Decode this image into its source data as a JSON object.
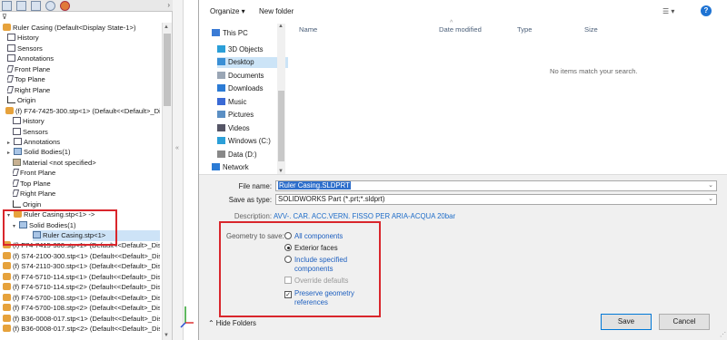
{
  "tree": {
    "items": [
      {
        "text": "Ruler Casing  (Default<Display State-1>)"
      },
      {
        "text": "History"
      },
      {
        "text": "Sensors"
      },
      {
        "text": "Annotations"
      },
      {
        "text": "Front Plane"
      },
      {
        "text": "Top Plane"
      },
      {
        "text": "Right Plane"
      },
      {
        "text": "Origin"
      },
      {
        "text": "(f) F74-7425-300.stp<1> (Default<<Default>_Displ"
      },
      {
        "text": "History"
      },
      {
        "text": "Sensors"
      },
      {
        "text": "Annotations"
      },
      {
        "text": "Solid Bodies(1)"
      },
      {
        "text": "Material <not specified>"
      },
      {
        "text": "Front Plane"
      },
      {
        "text": "Top Plane"
      },
      {
        "text": "Right Plane"
      },
      {
        "text": "Origin"
      },
      {
        "text": "Ruler Casing.stp<1> ->"
      },
      {
        "text": "Solid Bodies(1)"
      },
      {
        "text": "Ruler Casing.stp<1>"
      },
      {
        "text": "(f) F74-7415-300.stp<1> (Default<<Default>_Displ"
      },
      {
        "text": "(f) S74-2100-300.stp<1> (Default<<Default>_Displ"
      },
      {
        "text": "(f) S74-2110-300.stp<1> (Default<<Default>_Displ"
      },
      {
        "text": "(f) F74-5710-114.stp<1> (Default<<Default>_Displ"
      },
      {
        "text": "(f) F74-5710-114.stp<2> (Default<<Default>_Displ"
      },
      {
        "text": "(f) F74-5700-108.stp<1> (Default<<Default>_Displ"
      },
      {
        "text": "(f) F74-5700-108.stp<2> (Default<<Default>_Displ"
      },
      {
        "text": "(f) B36-0008-017.stp<1> (Default<<Default>_Displ"
      },
      {
        "text": "(f) B36-0008-017.stp<2> (Default<<Default>_Displ"
      }
    ]
  },
  "dialog": {
    "toolbar": {
      "organize": "Organize ▾",
      "new_folder": "New folder"
    },
    "nav": [
      {
        "label": "This PC"
      },
      {
        "label": "3D Objects"
      },
      {
        "label": "Desktop"
      },
      {
        "label": "Documents"
      },
      {
        "label": "Downloads"
      },
      {
        "label": "Music"
      },
      {
        "label": "Pictures"
      },
      {
        "label": "Videos"
      },
      {
        "label": "Windows (C:)"
      },
      {
        "label": "Data (D:)"
      },
      {
        "label": "Network"
      }
    ],
    "columns": {
      "name": "Name",
      "date": "Date modified",
      "type": "Type",
      "size": "Size"
    },
    "empty_message": "No items match your search.",
    "file_name_label": "File name:",
    "file_name_value": "Ruler Casing.SLDPRT",
    "save_type_label": "Save as type:",
    "save_type_value": "SOLIDWORKS Part (*.prt;*.sldprt)",
    "description_label": "Description:",
    "description_value": "AVV-. CAR. ACC.VERN. FISSO PER ARIA-ACQUA 20bar",
    "geometry_label": "Geometry to save:",
    "options": {
      "all_components": "All components",
      "exterior_faces": "Exterior faces",
      "include_specified_1": "Include specified",
      "include_specified_2": "components",
      "override_defaults": "Override defaults",
      "preserve_geometry_1": "Preserve geometry",
      "preserve_geometry_2": "references"
    },
    "selected_geometry": "Exterior faces",
    "preserve_checked": true,
    "hide_folders": "Hide Folders",
    "save_button": "Save",
    "cancel_button": "Cancel"
  },
  "colors": {
    "highlight_red": "#d9262c",
    "selection_blue": "#2d6ecb",
    "link_blue": "#1d6cc8"
  }
}
